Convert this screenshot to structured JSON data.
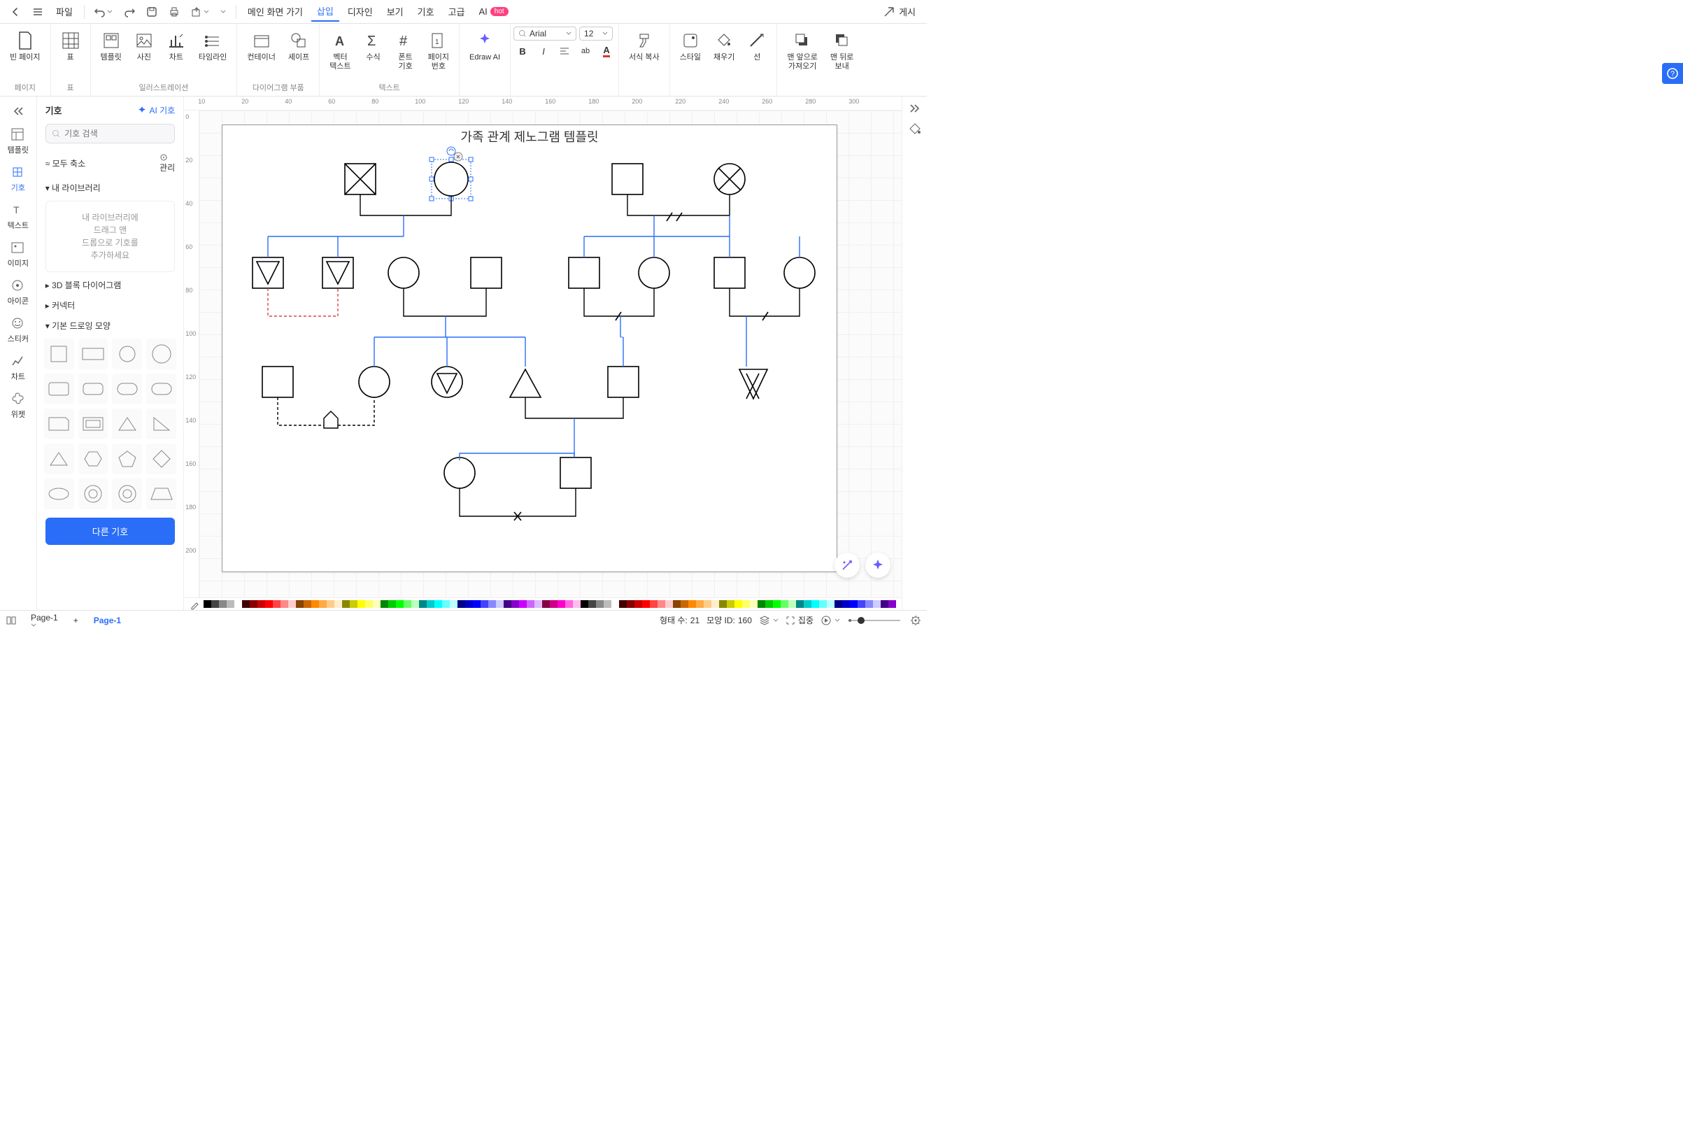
{
  "menubar": {
    "file": "파일",
    "home": "메인 화면 가기",
    "insert": "삽입",
    "design": "디자인",
    "view": "보기",
    "symbol": "기호",
    "advanced": "고급",
    "ai": "AI",
    "ai_badge": "hot",
    "publish": "게시"
  },
  "ribbon": {
    "blank_page": "빈 페이지",
    "table": "표",
    "template": "템플릿",
    "photo": "사진",
    "chart": "차트",
    "timeline": "타임라인",
    "container": "컨테이너",
    "shapes": "셰이프",
    "vector_text": "벡터\n텍스트",
    "formula": "수식",
    "font_symbol": "폰트\n기호",
    "page_number": "페이지\n번호",
    "edraw_ai": "Edraw AI",
    "font_name": "Arial",
    "font_size": "12",
    "format_painter": "서식 복사",
    "style": "스타일",
    "fill": "채우기",
    "line": "선",
    "bring_front": "맨 앞으로\n가져오기",
    "send_back": "맨 뒤로\n보내",
    "group_page": "페이지",
    "group_table": "표",
    "group_illustration": "일러스트레이션",
    "group_diagram_parts": "다이어그램 부품",
    "group_text": "텍스트"
  },
  "left": {
    "template": "템플릿",
    "symbol": "기호",
    "text": "텍스트",
    "image": "이미지",
    "icon": "아이콘",
    "sticker": "스티커",
    "chart": "차트",
    "widget": "위젯"
  },
  "panel": {
    "title": "기호",
    "ai_symbol": "AI 기호",
    "search_placeholder": "기호 검색",
    "collapse_all": "모두 축소",
    "manage": "관리",
    "my_library": "내 라이브러리",
    "my_library_hint": "내 라이브러리에\n드래그 앤\n드롭으로 기호를\n추가하세요",
    "block_3d": "3D 블록 다이어그램",
    "connector": "커넥터",
    "basic_shapes": "기본 드로잉 모양",
    "more_symbols": "다른 기호"
  },
  "canvas": {
    "title": "가족 관계 제노그램 템플릿",
    "ruler_h": [
      "10",
      "20",
      "40",
      "60",
      "80",
      "100",
      "120",
      "140",
      "160",
      "180",
      "200",
      "220",
      "240",
      "260",
      "280",
      "300"
    ],
    "ruler_v": [
      "0",
      "20",
      "40",
      "60",
      "80",
      "100",
      "120",
      "140",
      "160",
      "180",
      "200"
    ]
  },
  "status": {
    "page_sel": "Page-1",
    "tab_page": "Page-1",
    "shape_count_lbl": "형태 수:",
    "shape_count_val": "21",
    "shape_id_lbl": "모양 ID:",
    "shape_id_val": "160",
    "zoom_lbl": "집중"
  }
}
